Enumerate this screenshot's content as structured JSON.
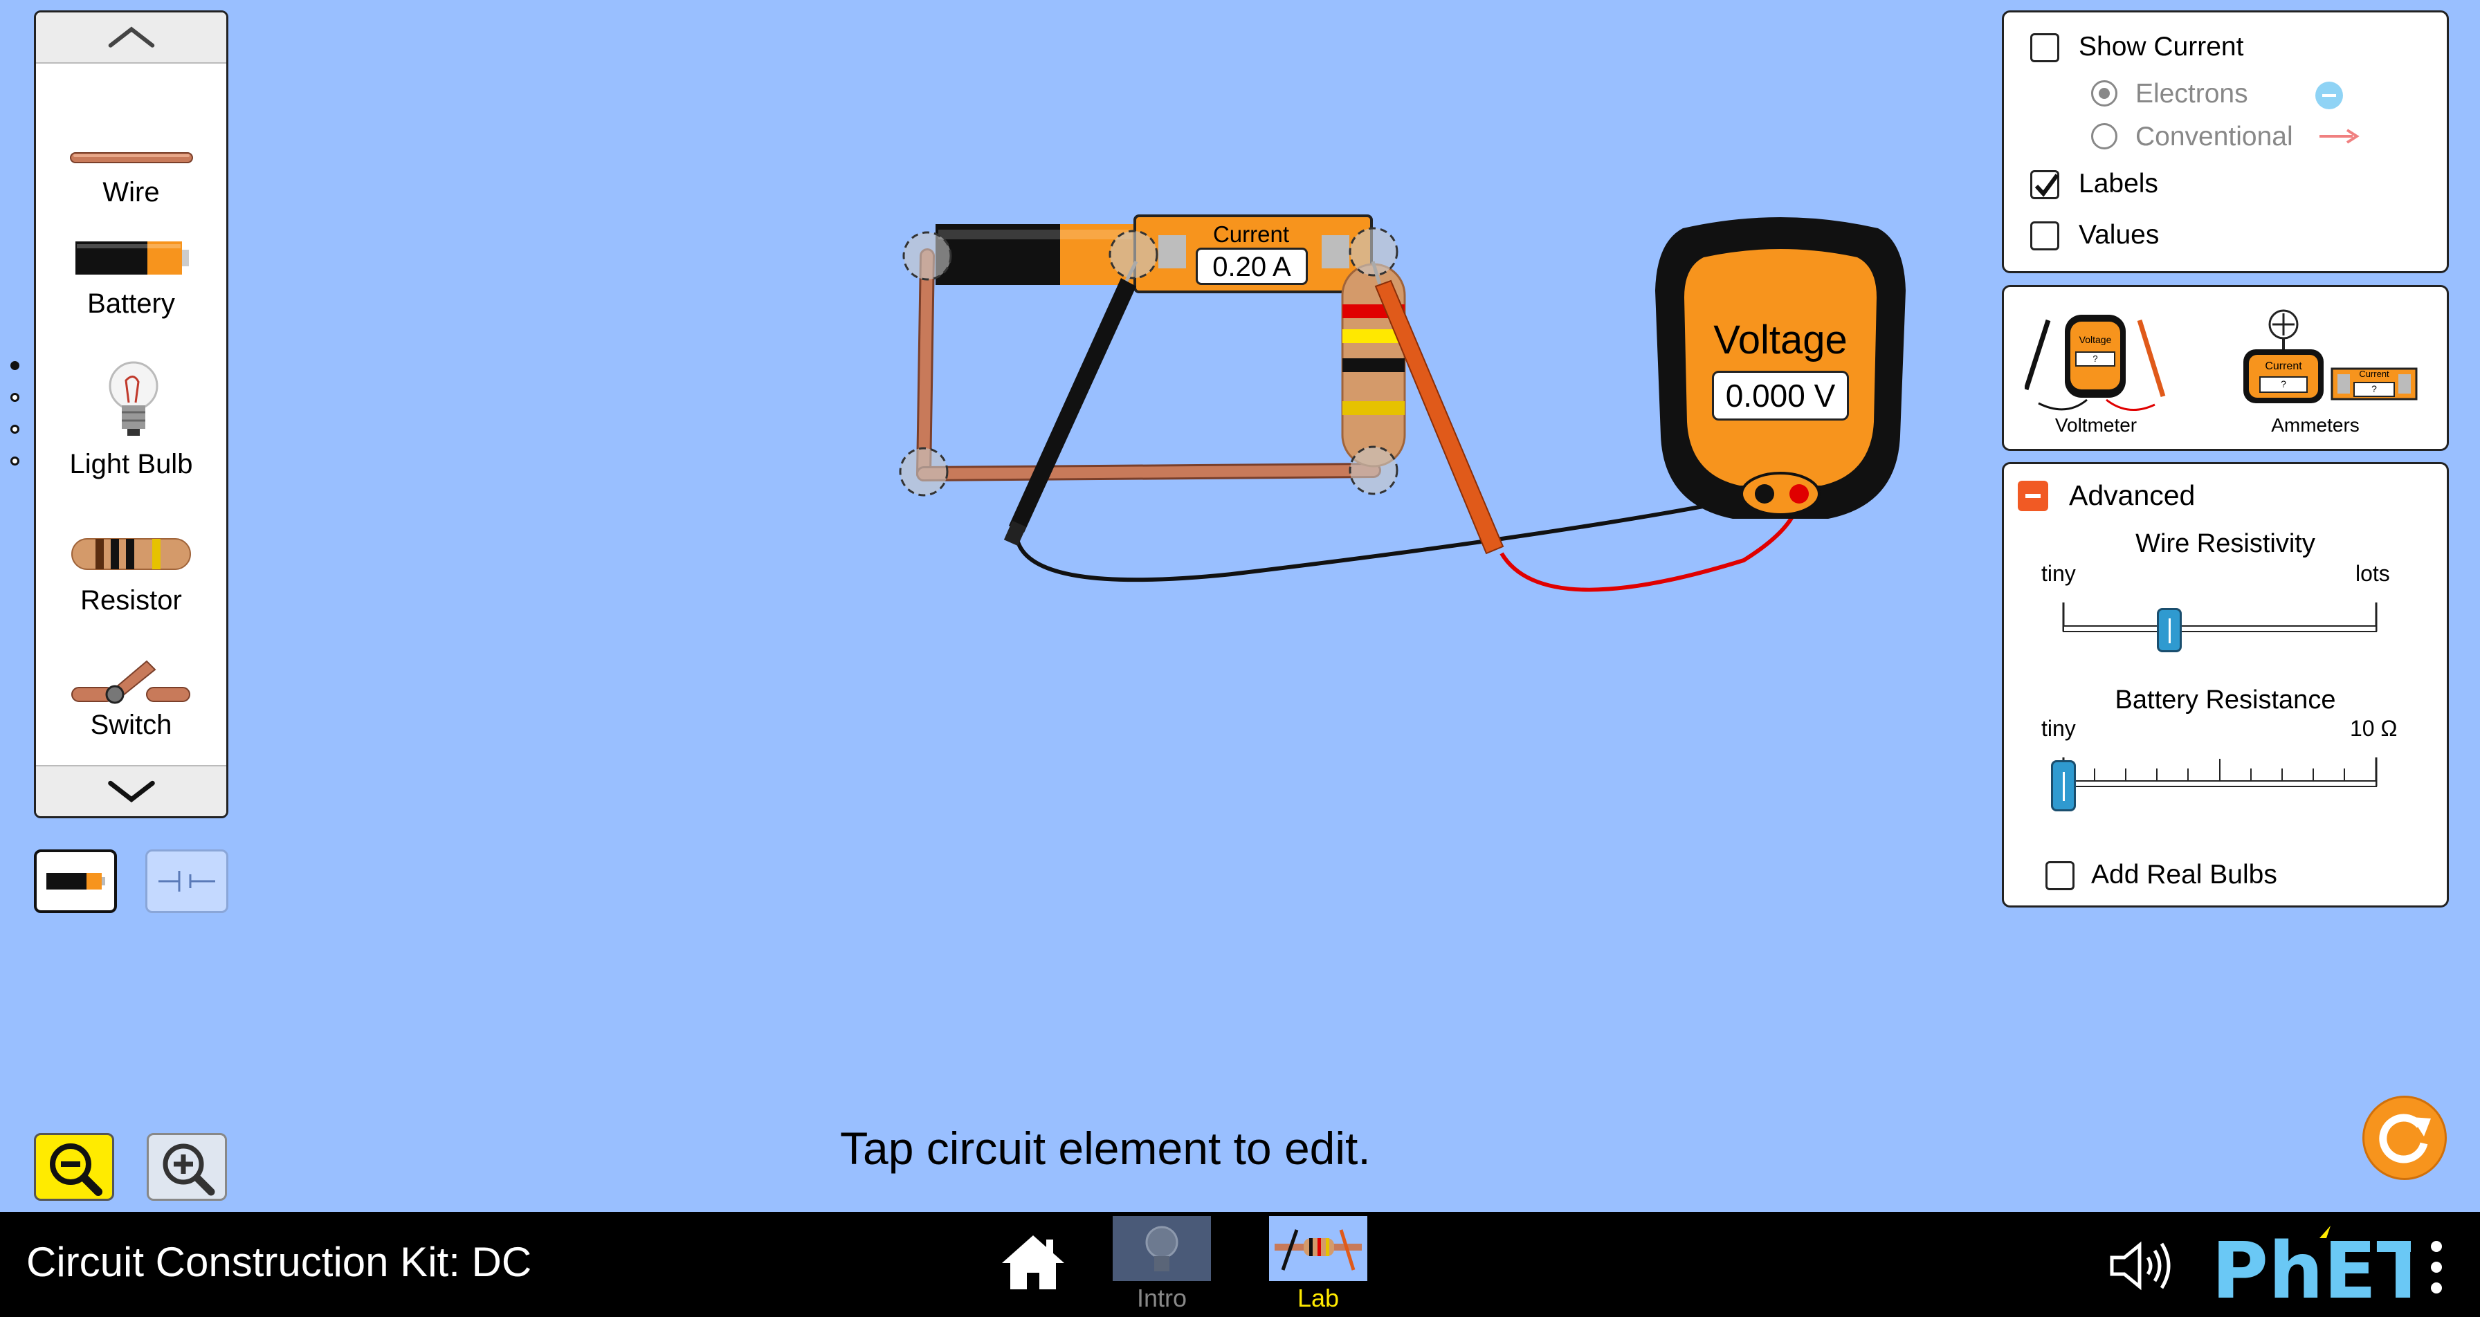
{
  "app": {
    "title": "Circuit Construction Kit: DC"
  },
  "toolbox": {
    "items": [
      {
        "label": "Wire",
        "icon": "wire-icon"
      },
      {
        "label": "Battery",
        "icon": "battery-icon"
      },
      {
        "label": "Light Bulb",
        "icon": "light-bulb-icon"
      },
      {
        "label": "Resistor",
        "icon": "resistor-icon"
      },
      {
        "label": "Switch",
        "icon": "switch-icon"
      }
    ],
    "page_count": 4,
    "active_page": 1
  },
  "view": {
    "lifelike_selected": true
  },
  "circuit": {
    "ammeter_label": "Current",
    "ammeter_value": "0.20 A"
  },
  "voltmeter": {
    "label": "Voltage",
    "value": "0.000 V"
  },
  "display_panel": {
    "show_current": {
      "label": "Show Current",
      "checked": false
    },
    "electrons": {
      "label": "Electrons",
      "selected": true
    },
    "conventional": {
      "label": "Conventional",
      "selected": false
    },
    "labels": {
      "label": "Labels",
      "checked": true
    },
    "values": {
      "label": "Values",
      "checked": false
    }
  },
  "sensor_panel": {
    "voltmeter_label": "Voltmeter",
    "ammeters_label": "Ammeters",
    "voltmeter_icon_text": "Voltage",
    "ammeter_icon_text": "Current",
    "unknown_value": "?"
  },
  "advanced_panel": {
    "title": "Advanced",
    "expanded": true,
    "wire_resistivity": {
      "label": "Wire Resistivity",
      "min_label": "tiny",
      "max_label": "lots",
      "value_fraction": 0.33
    },
    "battery_resistance": {
      "label": "Battery Resistance",
      "min_label": "tiny",
      "max_label": "10 Ω",
      "value_fraction": 0.0
    },
    "add_real_bulbs": {
      "label": "Add Real Bulbs",
      "checked": false
    }
  },
  "hint": "Tap circuit element to edit.",
  "screens": [
    {
      "label": "Intro",
      "selected": false
    },
    {
      "label": "Lab",
      "selected": true
    }
  ],
  "brand": "PhET",
  "colors": {
    "background": "#99bfff",
    "orange": "#f7941d",
    "copper": "#c87a5a",
    "lab_selected": "#ffea00",
    "zoom_active": "#ffeb00"
  }
}
